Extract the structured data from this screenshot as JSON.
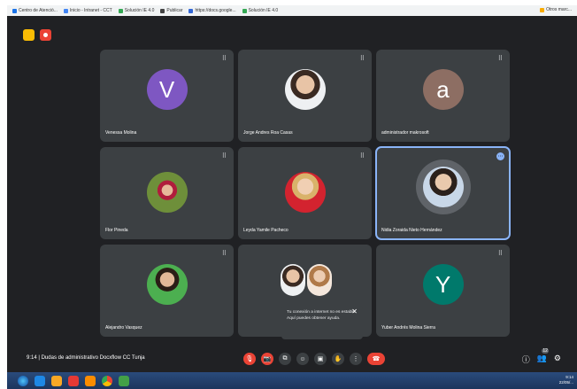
{
  "bookmarks": [
    {
      "label": "Centro de Atenció...",
      "color": "#1a73e8"
    },
    {
      "label": "Inicio - Intranet - CCT",
      "color": "#4285f4"
    },
    {
      "label": "Solución IE 4.0",
      "color": "#34a853"
    },
    {
      "label": "Publicar",
      "color": "#444444"
    },
    {
      "label": "https://docs.google...",
      "color": "#3367d6"
    },
    {
      "label": "Solución IE 4.0",
      "color": "#34a853"
    }
  ],
  "bookmarks_other": "Otros marc...",
  "tiles": [
    {
      "name": "Venessa Molina",
      "initial": "V",
      "color": "#7e57c2"
    },
    {
      "name": "Jorge Andres Roa Casas"
    },
    {
      "name": "administrador makrosoft",
      "initial": "a",
      "color": "#8d6e63"
    },
    {
      "name": "Flor Pineda"
    },
    {
      "name": "Leyda Yamile Pacheco"
    },
    {
      "name": "Nidia Zoraida Nieto Hernández"
    },
    {
      "name": "Alejandro Vasquez"
    },
    {
      "name": ""
    },
    {
      "name": "Yuber Andrés Molina Sierra",
      "initial": "Y",
      "color": "#00796b"
    }
  ],
  "toast": {
    "text": "Tu conexión a internet no es estable. Aquí puedes obtener ayuda.",
    "close": "✕"
  },
  "meeting": {
    "time": "9:14",
    "title": "Dudas de administrativo Docxflow CC Tunja"
  },
  "icons": {
    "mic": "🎙",
    "camera": "📷",
    "captions": "⧉",
    "emoji": "☺",
    "present": "▣",
    "hand": "✋",
    "more": "⋮",
    "end": "☎",
    "info": "ⓘ",
    "people": "👥",
    "activities": "⚙",
    "tile_more": "⠿",
    "pin": "⋯",
    "toast_close": "✕"
  },
  "people_badge": "12",
  "tray": {
    "time": "9:14",
    "date": "22/05/..."
  }
}
